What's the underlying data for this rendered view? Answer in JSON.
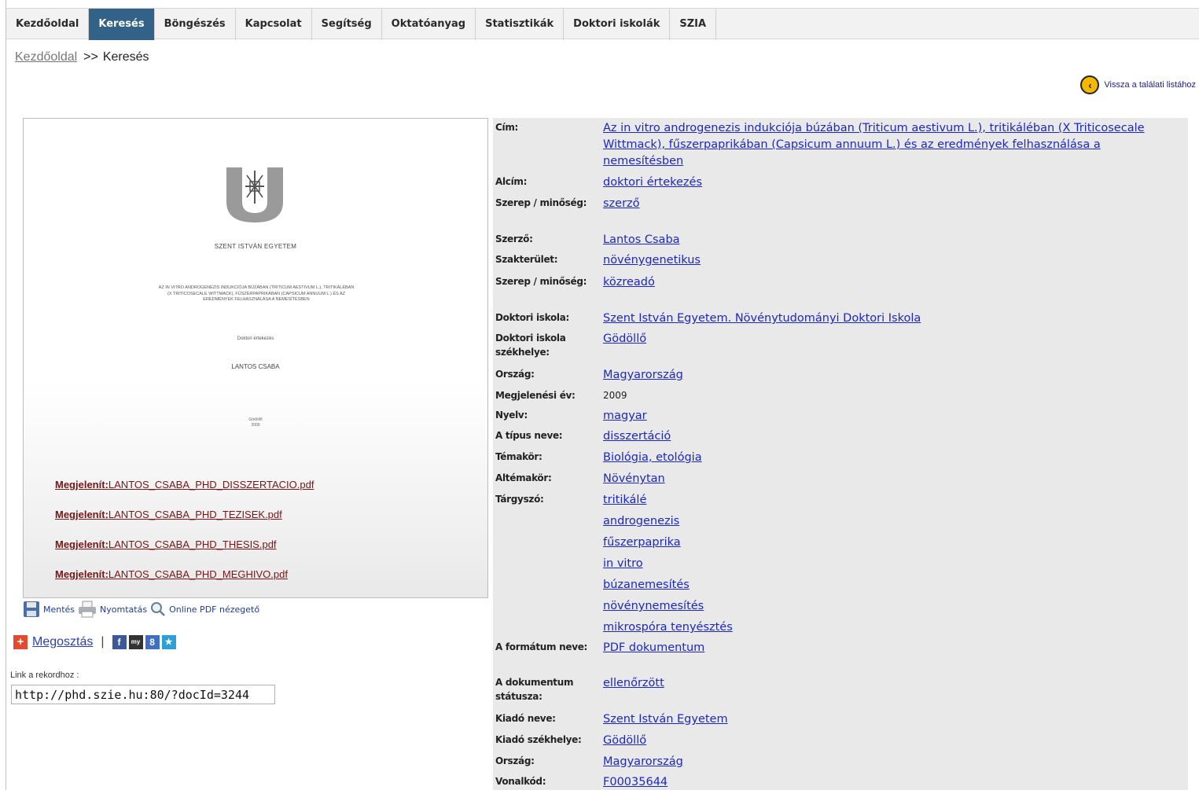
{
  "nav": {
    "items": [
      "Kezdőoldal",
      "Keresés",
      "Böngészés",
      "Kapcsolat",
      "Segítség",
      "Oktatóanyag",
      "Statisztikák",
      "Doktori iskolák",
      "SZIA"
    ],
    "active": "Keresés"
  },
  "breadcrumb": {
    "home": "Kezdőoldal",
    "separator": ">>",
    "current": "Keresés"
  },
  "back_link": "Vissza a találati listához",
  "preview": {
    "university": "SZENT ISTVÁN EGYETEM",
    "title": "Az in vitro androgenezis indukciója búzában (Triticum aestivum L.), tritikáléban (X Triticosecale Wittmack), fűszerpaprikában (Capsicum annuum L.) és az eredmények felhasználása a nemesítésben",
    "type": "Doktori értekezés",
    "author": "LANTOS CSABA",
    "place": "Gödöllő",
    "year": "2009"
  },
  "pdf_links": [
    {
      "prefix": "Megjelenít:",
      "file": "LANTOS_CSABA_PHD_DISSZERTACIO.pdf"
    },
    {
      "prefix": "Megjelenít:",
      "file": "LANTOS_CSABA_PHD_TEZISEK.pdf"
    },
    {
      "prefix": "Megjelenít:",
      "file": "LANTOS_CSABA_PHD_THESIS.pdf"
    },
    {
      "prefix": "Megjelenít:",
      "file": "LANTOS_CSABA_PHD_MEGHIVO.pdf"
    }
  ],
  "actions": {
    "save": "Mentés",
    "print": "Nyomtatás",
    "pdf_viewer": "Online PDF nézegető"
  },
  "share": {
    "label": "Megosztás",
    "pipe": "|",
    "icons": [
      "facebook-icon",
      "myspace-icon",
      "google-plus-icon",
      "twitter-icon"
    ]
  },
  "record_link": {
    "label": "Link a rekordhoz :",
    "value": "http://phd.szie.hu:80/?docId=3244"
  },
  "metadata": {
    "cim_label": "Cím:",
    "cim": "Az in vitro androgenezis indukciója búzában (Triticum aestivum L.), tritikáléban (X Triticosecale Wittmack), fűszerpaprikában (Capsicum annuum L.) és az eredmények felhasználása a nemesítésben",
    "alcim_label": "Alcím:",
    "alcim": "doktori értekezés",
    "szerep1_label": "Szerep / minőség:",
    "szerep1": "szerző",
    "szerzo_label": "Szerző:",
    "szerzo": "Lantos Csaba",
    "szakterulet_label": "Szakterület:",
    "szakterulet": "növénygenetikus",
    "szerep2_label": "Szerep / minőség:",
    "szerep2": "közreadó",
    "doktori_iskola_label": "Doktori iskola:",
    "doktori_iskola": "Szent István Egyetem. Növénytudományi Doktori Iskola",
    "iskola_szekhely_label": "Doktori iskola székhelye:",
    "iskola_szekhely": "Gödöllő",
    "orszag_label": "Ország:",
    "orszag": "Magyarország",
    "ev_label": "Megjelenési év:",
    "ev": "2009",
    "nyelv_label": "Nyelv:",
    "nyelv": "magyar",
    "tipus_label": "A típus neve:",
    "tipus": "disszertáció",
    "temakor_label": "Témakör:",
    "temakor": "Biológia, etológia",
    "altemakor_label": "Altémakör:",
    "altemakor": "Növénytan",
    "targyszo_label": "Tárgyszó:",
    "targyszavak": [
      "tritikálé",
      "androgenezis",
      "fűszerpaprika",
      "in vitro",
      "búzanemesítés",
      "növénynemesítés",
      "mikrospóra tenyésztés"
    ],
    "formatum_label": "A formátum neve:",
    "formatum": "PDF dokumentum",
    "statusz_label": "A dokumentum státusza:",
    "statusz": "ellenőrzött",
    "kiado_label": "Kiadó neve:",
    "kiado": "Szent István Egyetem",
    "kiado_szekhely_label": "Kiadó székhelye:",
    "kiado_szekhely": "Gödöllő",
    "orszag2_label": "Ország:",
    "orszag2": "Magyarország",
    "vonalkod_label": "Vonalkód:",
    "vonalkod": "F00035644"
  },
  "colors": {
    "nav_active": "#336288",
    "link": "#1c27c9",
    "pdf_link": "#7a1515",
    "meta_bg": "#e9e9e9"
  }
}
